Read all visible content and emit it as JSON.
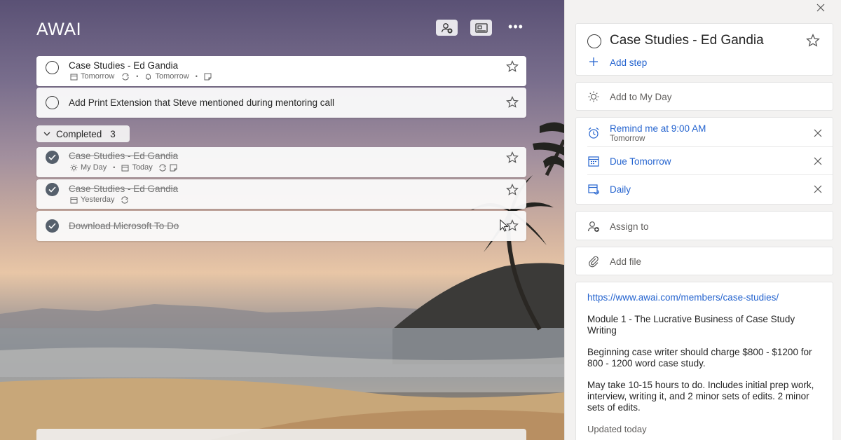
{
  "list": {
    "title": "AWAI",
    "toolbar": {
      "share_icon": "share-people-icon",
      "view_icon": "view-icon",
      "more_label": "•••"
    }
  },
  "tasks": [
    {
      "title": "Case Studies - Ed Gandia",
      "meta": [
        "Tomorrow",
        "Tomorrow"
      ],
      "selected": true
    },
    {
      "title": "Add Print Extension that Steve mentioned during mentoring call",
      "meta": []
    }
  ],
  "completed_section": {
    "label": "Completed",
    "count": "3"
  },
  "completed_tasks": [
    {
      "title": "Case Studies - Ed Gandia",
      "meta": [
        "My Day",
        "Today"
      ]
    },
    {
      "title": "Case Studies - Ed Gandia",
      "meta": [
        "Yesterday"
      ]
    },
    {
      "title": "Download Microsoft To Do",
      "meta": []
    }
  ],
  "detail": {
    "title": "Case Studies - Ed Gandia",
    "add_step": "Add step",
    "add_my_day": "Add to My Day",
    "remind": "Remind me at 9:00 AM",
    "remind_sub": "Tomorrow",
    "due": "Due Tomorrow",
    "repeat": "Daily",
    "assign": "Assign to",
    "add_file": "Add file",
    "note": {
      "link": "https://www.awai.com/members/case-studies/",
      "p1": "Module 1 - The Lucrative Business of Case Study Writing",
      "p2": "Beginning case writer should charge $800 - $1200 for 800 - 1200 word case study.",
      "p3": "May take 10-15 hours to do. Includes initial prep work, interview, writing it, and 2 minor sets of edits. 2 minor sets of edits.",
      "updated": "Updated today"
    }
  },
  "colors": {
    "accent": "#2564cf",
    "pane_bg": "#f3f2f1",
    "done_check": "#56606c"
  }
}
